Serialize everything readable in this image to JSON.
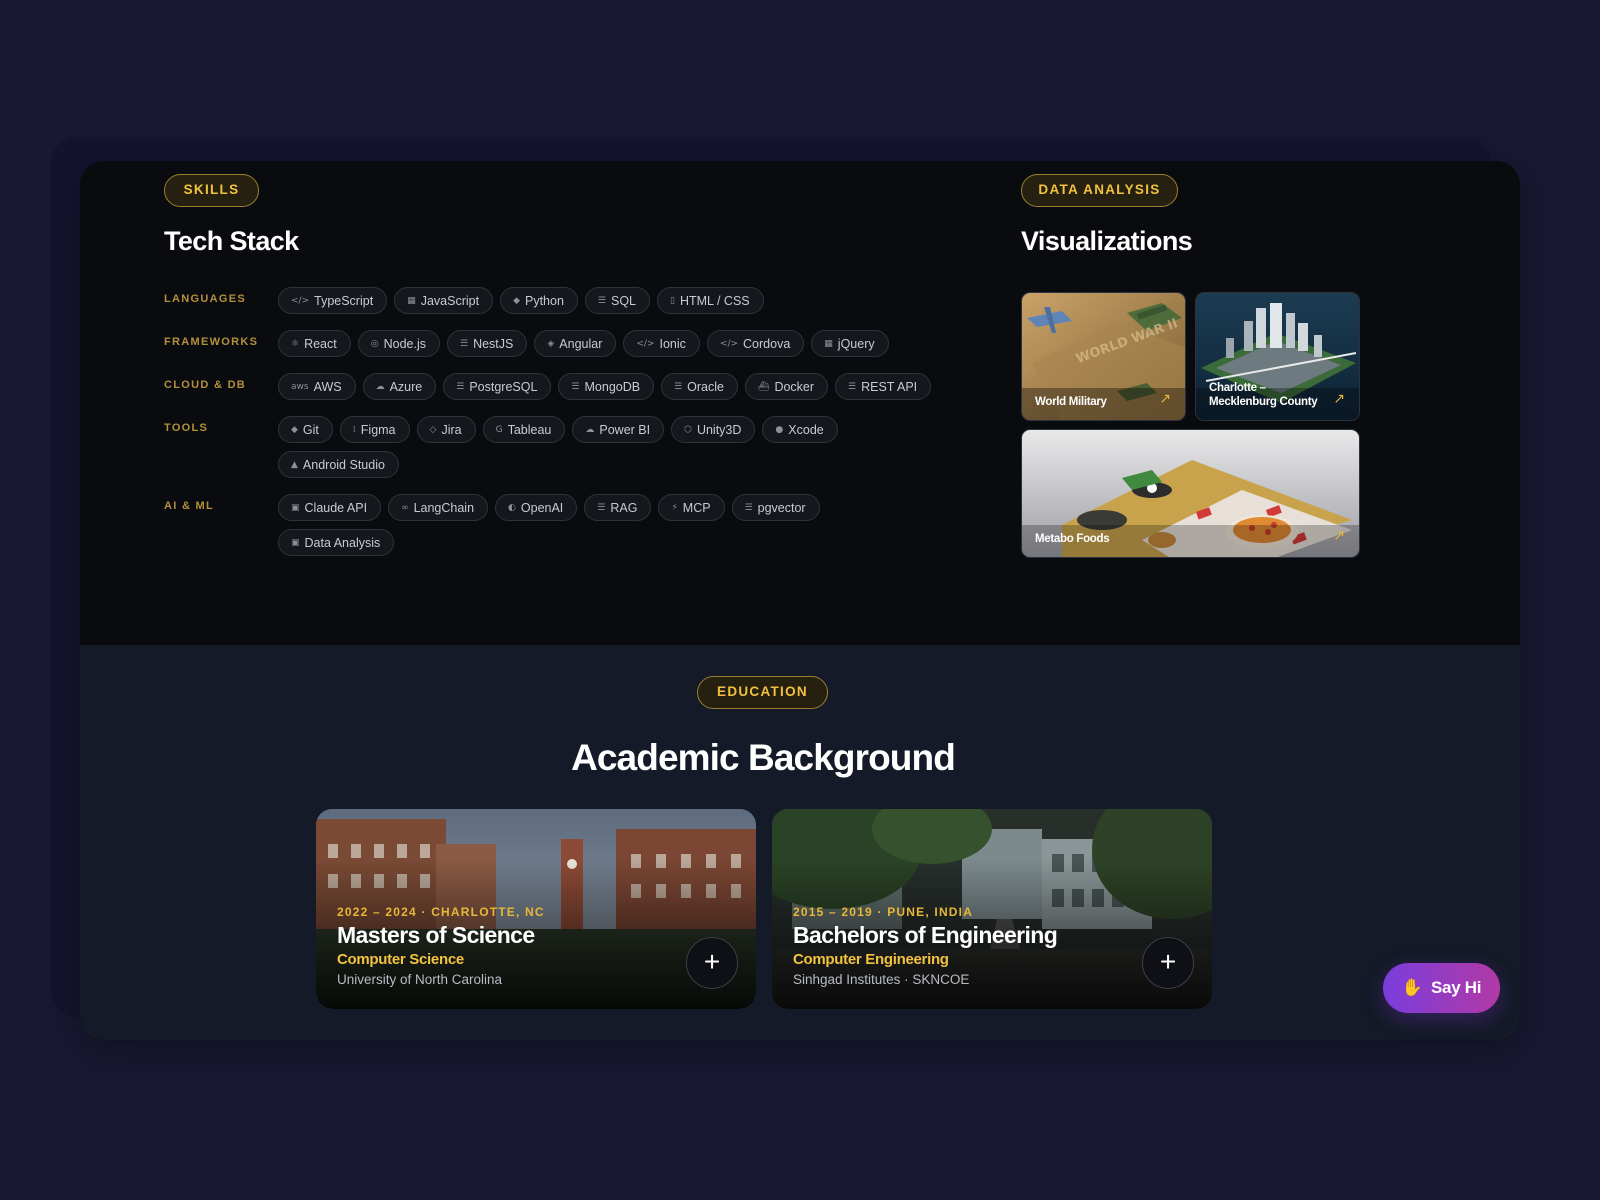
{
  "skills": {
    "badge": "SKILLS",
    "title": "Tech Stack",
    "categories": [
      {
        "label": "LANGUAGES",
        "tags": [
          {
            "icon": "</>",
            "name": "TypeScript"
          },
          {
            "icon": "▦",
            "name": "JavaScript"
          },
          {
            "icon": "◆",
            "name": "Python"
          },
          {
            "icon": "☰",
            "name": "SQL"
          },
          {
            "icon": "▯",
            "name": "HTML / CSS"
          }
        ]
      },
      {
        "label": "FRAMEWORKS",
        "tags": [
          {
            "icon": "⚛",
            "name": "React"
          },
          {
            "icon": "◎",
            "name": "Node.js"
          },
          {
            "icon": "☰",
            "name": "NestJS"
          },
          {
            "icon": "◈",
            "name": "Angular"
          },
          {
            "icon": "</>",
            "name": "Ionic"
          },
          {
            "icon": "</>",
            "name": "Cordova"
          },
          {
            "icon": "▦",
            "name": "jQuery"
          }
        ]
      },
      {
        "label": "CLOUD & DB",
        "tags": [
          {
            "icon": "aws",
            "name": "AWS"
          },
          {
            "icon": "☁",
            "name": "Azure"
          },
          {
            "icon": "☰",
            "name": "PostgreSQL"
          },
          {
            "icon": "☰",
            "name": "MongoDB"
          },
          {
            "icon": "☰",
            "name": "Oracle"
          },
          {
            "icon": "⛴",
            "name": "Docker"
          },
          {
            "icon": "☰",
            "name": "REST API"
          }
        ]
      },
      {
        "label": "TOOLS",
        "tags": [
          {
            "icon": "◆",
            "name": "Git"
          },
          {
            "icon": "⁞",
            "name": "Figma"
          },
          {
            "icon": "◇",
            "name": "Jira"
          },
          {
            "icon": "G",
            "name": "Tableau"
          },
          {
            "icon": "☁",
            "name": "Power BI"
          },
          {
            "icon": "⬡",
            "name": "Unity3D"
          },
          {
            "icon": "●",
            "name": "Xcode"
          },
          {
            "icon": "▲",
            "name": "Android Studio"
          }
        ]
      },
      {
        "label": "AI & ML",
        "tags": [
          {
            "icon": "▣",
            "name": "Claude API"
          },
          {
            "icon": "∞",
            "name": "LangChain"
          },
          {
            "icon": "◐",
            "name": "OpenAI"
          },
          {
            "icon": "☰",
            "name": "RAG"
          },
          {
            "icon": "⚡",
            "name": "MCP"
          },
          {
            "icon": "☰",
            "name": "pgvector"
          },
          {
            "icon": "▣",
            "name": "Data Analysis"
          }
        ]
      }
    ]
  },
  "viz": {
    "badge": "DATA ANALYSIS",
    "title": "Visualizations",
    "items": [
      {
        "label": "World Military"
      },
      {
        "label": "Charlotte – Mecklenburg County"
      },
      {
        "label": "Metabo Foods"
      }
    ]
  },
  "education": {
    "badge": "EDUCATION",
    "title": "Academic Background",
    "items": [
      {
        "meta": "2022 – 2024 · CHARLOTTE, NC",
        "degree": "Masters of Science",
        "field": "Computer Science",
        "school": "University of North Carolina"
      },
      {
        "meta": "2015 – 2019 · PUNE, INDIA",
        "degree": "Bachelors of Engineering",
        "field": "Computer Engineering",
        "school": "Sinhgad Institutes · SKNCOE"
      }
    ]
  },
  "say_hi": {
    "label": "Say Hi",
    "emoji": "✋"
  }
}
